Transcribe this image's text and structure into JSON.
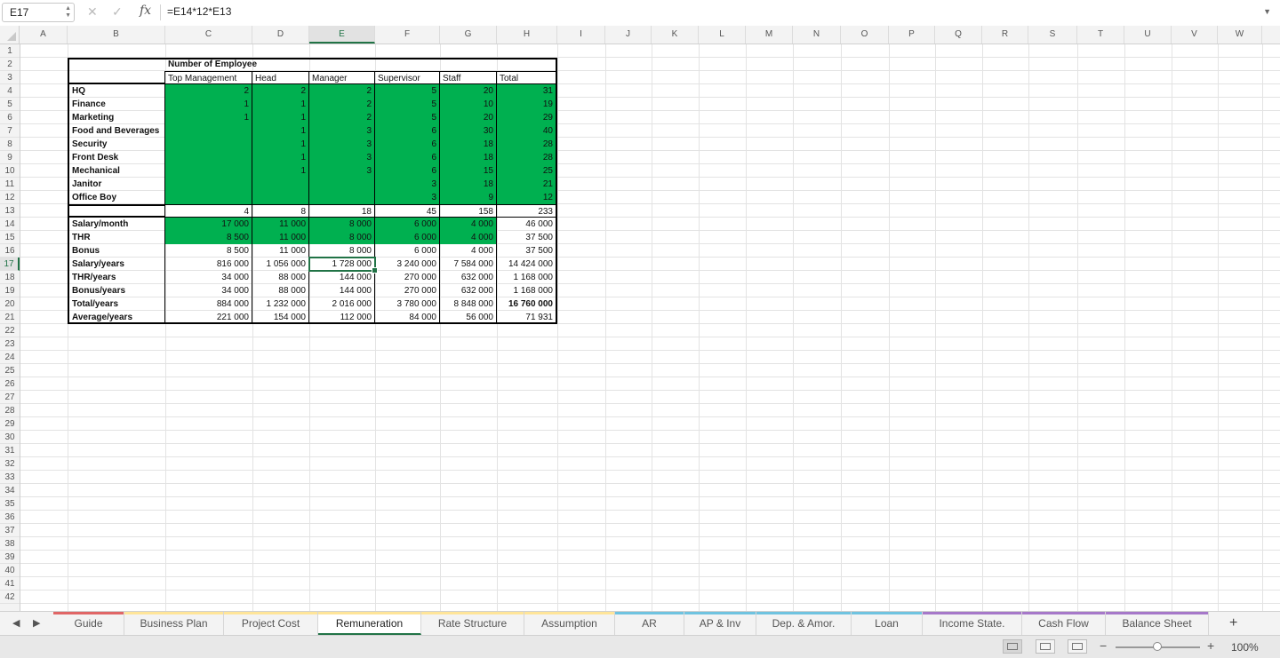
{
  "formula_bar": {
    "name_box": "E17",
    "formula": "=E14*12*E13"
  },
  "columns": [
    "A",
    "B",
    "C",
    "D",
    "E",
    "F",
    "G",
    "H",
    "I",
    "J",
    "K",
    "L",
    "M",
    "N",
    "O",
    "P",
    "Q",
    "R",
    "S",
    "T",
    "U",
    "V",
    "W"
  ],
  "rows": [
    "1",
    "2",
    "3",
    "4",
    "5",
    "6",
    "7",
    "8",
    "9",
    "10",
    "11",
    "12",
    "13",
    "14",
    "15",
    "16",
    "17",
    "18",
    "19",
    "20",
    "21",
    "22",
    "23",
    "24",
    "25",
    "26",
    "27",
    "28",
    "29",
    "30",
    "31",
    "32",
    "33",
    "34",
    "35",
    "36",
    "37",
    "38",
    "39",
    "40",
    "41",
    "42"
  ],
  "selected": {
    "column": "E",
    "row": "17"
  },
  "table": {
    "group_header": "Number of Employee",
    "headers": [
      "Top Management",
      "Head",
      "Manager",
      "Supervisor",
      "Staff",
      "Total"
    ],
    "departments": [
      {
        "name": "HQ",
        "values": [
          "2",
          "2",
          "2",
          "5",
          "20",
          "31"
        ]
      },
      {
        "name": "Finance",
        "values": [
          "1",
          "1",
          "2",
          "5",
          "10",
          "19"
        ]
      },
      {
        "name": "Marketing",
        "values": [
          "1",
          "1",
          "2",
          "5",
          "20",
          "29"
        ]
      },
      {
        "name": "Food and Beverages",
        "values": [
          "",
          "1",
          "3",
          "6",
          "30",
          "40"
        ]
      },
      {
        "name": "Security",
        "values": [
          "",
          "1",
          "3",
          "6",
          "18",
          "28"
        ]
      },
      {
        "name": "Front Desk",
        "values": [
          "",
          "1",
          "3",
          "6",
          "18",
          "28"
        ]
      },
      {
        "name": "Mechanical",
        "values": [
          "",
          "1",
          "3",
          "6",
          "15",
          "25"
        ]
      },
      {
        "name": "Janitor",
        "values": [
          "",
          "",
          "",
          "3",
          "18",
          "21"
        ]
      },
      {
        "name": "Office Boy",
        "values": [
          "",
          "",
          "",
          "3",
          "9",
          "12"
        ]
      }
    ],
    "totals": [
      "4",
      "8",
      "18",
      "45",
      "158",
      "233"
    ],
    "metrics": [
      {
        "name": "Salary/month",
        "values": [
          "17 000",
          "11 000",
          "8 000",
          "6 000",
          "4 000",
          "46 000"
        ],
        "green": true
      },
      {
        "name": "THR",
        "values": [
          "8 500",
          "11 000",
          "8 000",
          "6 000",
          "4 000",
          "37 500"
        ],
        "green": true
      },
      {
        "name": "Bonus",
        "values": [
          "8 500",
          "11 000",
          "8 000",
          "6 000",
          "4 000",
          "37 500"
        ]
      },
      {
        "name": "Salary/years",
        "values": [
          "816 000",
          "1 056 000",
          "1 728 000",
          "3 240 000",
          "7 584 000",
          "14 424 000"
        ]
      },
      {
        "name": "THR/years",
        "values": [
          "34 000",
          "88 000",
          "144 000",
          "270 000",
          "632 000",
          "1 168 000"
        ]
      },
      {
        "name": "Bonus/years",
        "values": [
          "34 000",
          "88 000",
          "144 000",
          "270 000",
          "632 000",
          "1 168 000"
        ]
      },
      {
        "name": "Total/years",
        "values": [
          "884 000",
          "1 232 000",
          "2 016 000",
          "3 780 000",
          "8 848 000",
          "16 760 000"
        ],
        "bold_total": true
      },
      {
        "name": "Average/years",
        "values": [
          "221 000",
          "154 000",
          "112 000",
          "84 000",
          "56 000",
          "71 931"
        ]
      }
    ]
  },
  "colors": {
    "fill_green": "#00b050",
    "accent": "#217346"
  },
  "sheet_tabs": [
    {
      "label": "Guide",
      "color": "#e06666"
    },
    {
      "label": "Business Plan",
      "color": "#ffe599"
    },
    {
      "label": "Project Cost",
      "color": "#ffe599"
    },
    {
      "label": "Remuneration",
      "color": "#ffe599",
      "active": true
    },
    {
      "label": "Rate Structure",
      "color": "#ffe599"
    },
    {
      "label": "Assumption",
      "color": "#ffe599"
    },
    {
      "label": "AR",
      "color": "#6fc3e0"
    },
    {
      "label": "AP & Inv",
      "color": "#6fc3e0"
    },
    {
      "label": "Dep. & Amor.",
      "color": "#6fc3e0"
    },
    {
      "label": "Loan",
      "color": "#6fc3e0"
    },
    {
      "label": "Income State.",
      "color": "#a678c9"
    },
    {
      "label": "Cash Flow",
      "color": "#a678c9"
    },
    {
      "label": "Balance Sheet",
      "color": "#a678c9"
    }
  ],
  "status": {
    "zoom": "100%",
    "zoom_level": 1.0
  }
}
